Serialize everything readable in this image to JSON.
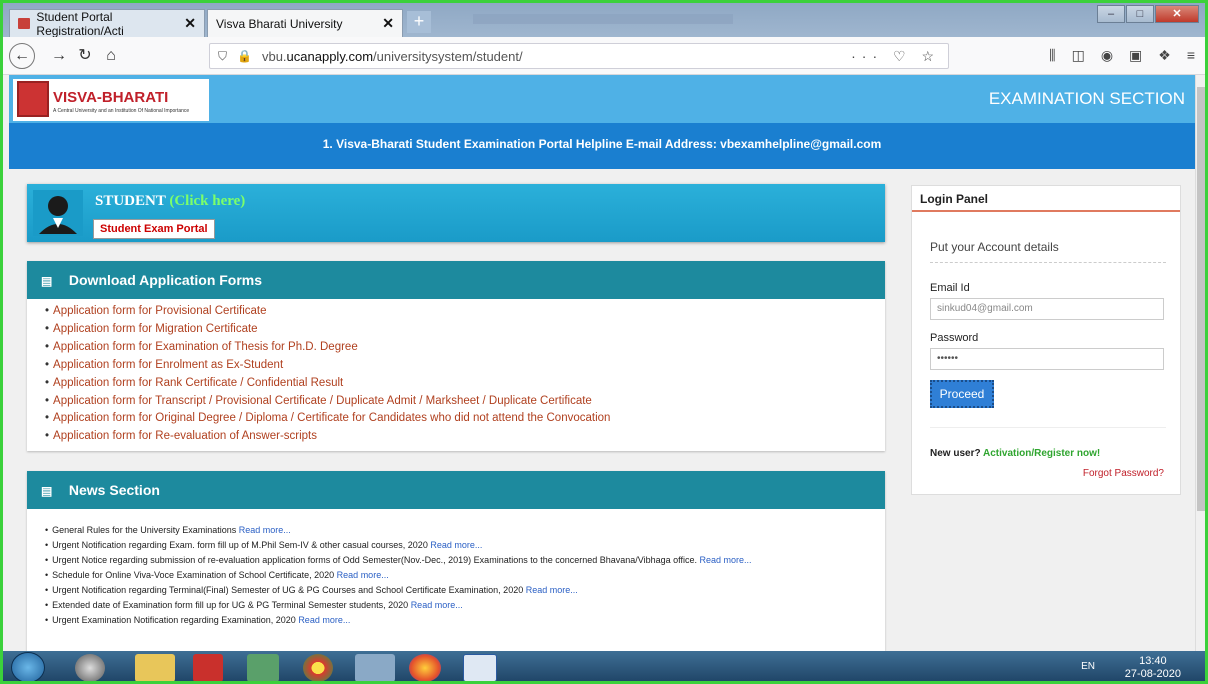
{
  "browser": {
    "tabs": [
      {
        "label": "Student Portal Registration/Acti"
      },
      {
        "label": "Visva Bharati University"
      }
    ],
    "url_prefix": "vbu.",
    "url_host": "ucanapply.com",
    "url_path": "/universitysystem/student/"
  },
  "header": {
    "logo_title": "VISVA-BHARATI",
    "logo_subtitle": "A Central University and an Institution Of National Importance",
    "section_title": "EXAMINATION SECTION",
    "helpline": "1. Visva-Bharati Student Examination Portal Helpline E-mail Address: vbexamhelpline@gmail.com"
  },
  "student": {
    "title": "STUDENT",
    "click": "(Click here)",
    "portal_button": "Student Exam Portal"
  },
  "forms": {
    "heading": "Download Application Forms",
    "items": [
      "Application form for Provisional Certificate",
      "Application form for Migration Certificate",
      "Application form for Examination of Thesis for Ph.D. Degree",
      "Application form for Enrolment as Ex-Student",
      "Application form for Rank Certificate / Confidential Result",
      "Application form for Transcript / Provisional Certificate / Duplicate Admit / Marksheet / Duplicate Certificate",
      "Application form for Original Degree / Diploma / Certificate for Candidates who did not attend the Convocation",
      "Application form for Re-evaluation of Answer-scripts"
    ]
  },
  "news": {
    "heading": "News Section",
    "read_more": "Read more...",
    "items": [
      "General Rules for the University Examinations",
      "Urgent Notification regarding Exam. form fill up of M.Phil Sem-IV & other casual courses, 2020",
      "Urgent Notice regarding submission of re-evaluation application forms of Odd Semester(Nov.-Dec., 2019) Examinations to the concerned Bhavana/Vibhaga office.",
      "Schedule for Online Viva-Voce Examination of School Certificate, 2020",
      "Urgent Notification regarding Terminal(Final) Semester of UG & PG Courses and School Certificate Examination, 2020",
      "Extended date of Examination form fill up for UG & PG Terminal Semester students, 2020",
      "Urgent Examination Notification regarding Examination, 2020"
    ]
  },
  "login": {
    "heading": "Login Panel",
    "subheading": "Put your Account details",
    "email_label": "Email Id",
    "email_value": "sinkud04@gmail.com",
    "password_label": "Password",
    "password_value": "••••••",
    "proceed": "Proceed",
    "new_user": "New user?",
    "activation": "Activation/Register now!",
    "forgot": "Forgot Password?"
  },
  "taskbar": {
    "lang": "EN",
    "time": "13:40",
    "date": "27-08-2020"
  }
}
